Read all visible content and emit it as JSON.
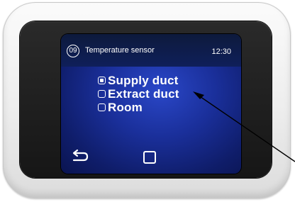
{
  "screen": {
    "menu_number": "09",
    "title": "Temperature sensor",
    "time": "12:30"
  },
  "options": [
    {
      "label": "Supply duct",
      "checked": true
    },
    {
      "label": "Extract duct",
      "checked": false
    },
    {
      "label": "Room",
      "checked": false
    }
  ],
  "icons": {
    "back": "back-arrow-icon",
    "home": "home-square-icon"
  },
  "colors": {
    "screen_blue": "#1a2f9a",
    "text": "#ffffff",
    "bezel": "#161616"
  }
}
